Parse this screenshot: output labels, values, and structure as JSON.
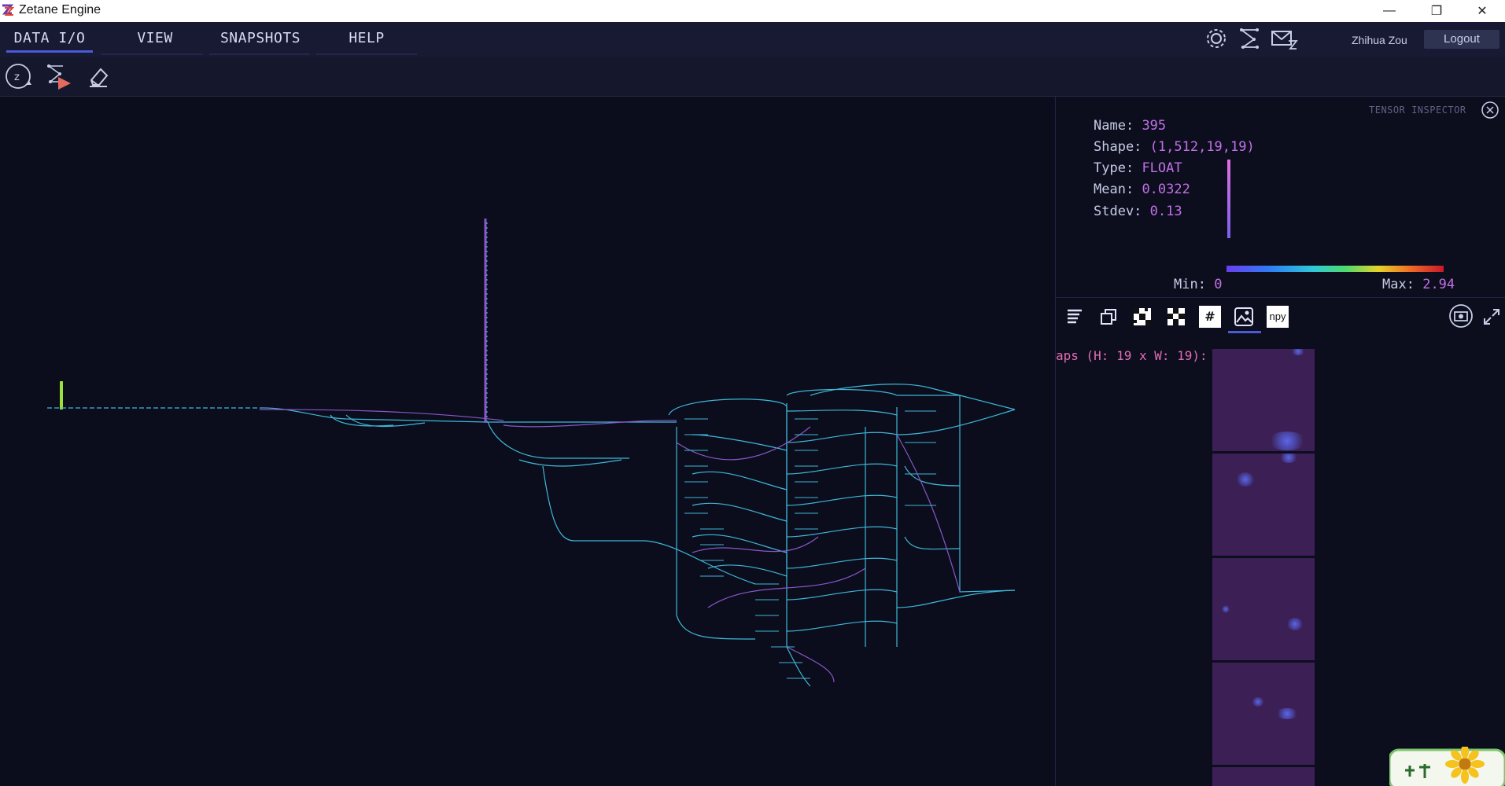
{
  "window": {
    "title": "Zetane Engine",
    "minimize": "—",
    "restore": "❐",
    "close": "✕"
  },
  "menu": {
    "items": [
      "DATA I/O",
      "VIEW",
      "SNAPSHOTS",
      "HELP"
    ],
    "active": "DATA I/O"
  },
  "header": {
    "user_name": "Zhihua Zou",
    "logout_label": "Logout",
    "icons": [
      "gear-icon",
      "graph-icon",
      "mail-icon"
    ]
  },
  "toolbar": {
    "icons": [
      "zetane-reset-icon",
      "run-graph-icon",
      "eraser-icon"
    ]
  },
  "inspector": {
    "title": "TENSOR INSPECTOR",
    "name_label": "Name:",
    "name_value": "395",
    "shape_label": "Shape:",
    "shape_value": "(1,512,19,19)",
    "type_label": "Type:",
    "type_value": "FLOAT",
    "mean_label": "Mean:",
    "mean_value": "0.0322",
    "stdev_label": "Stdev:",
    "stdev_value": "0.13",
    "min_label": "Min:",
    "min_value": "0",
    "max_label": "Max:",
    "max_value": "2.94",
    "tabs": [
      "list-icon",
      "copy-icon",
      "checker-icon",
      "checker-alt-icon",
      "hash-icon",
      "image-icon",
      "npy-icon"
    ],
    "npy_label": "npy",
    "hash_label": "#",
    "active_tab": "image-icon",
    "feature_maps_label": "aps (H: 19 x W: 19):"
  },
  "colors": {
    "accent": "#4a5bd9",
    "value_purple": "#c170e6",
    "feature_label": "#e36bb4",
    "graph_cyan": "#3fb7d8",
    "graph_purple": "#8a56c8",
    "input_marker": "#9be03a"
  }
}
